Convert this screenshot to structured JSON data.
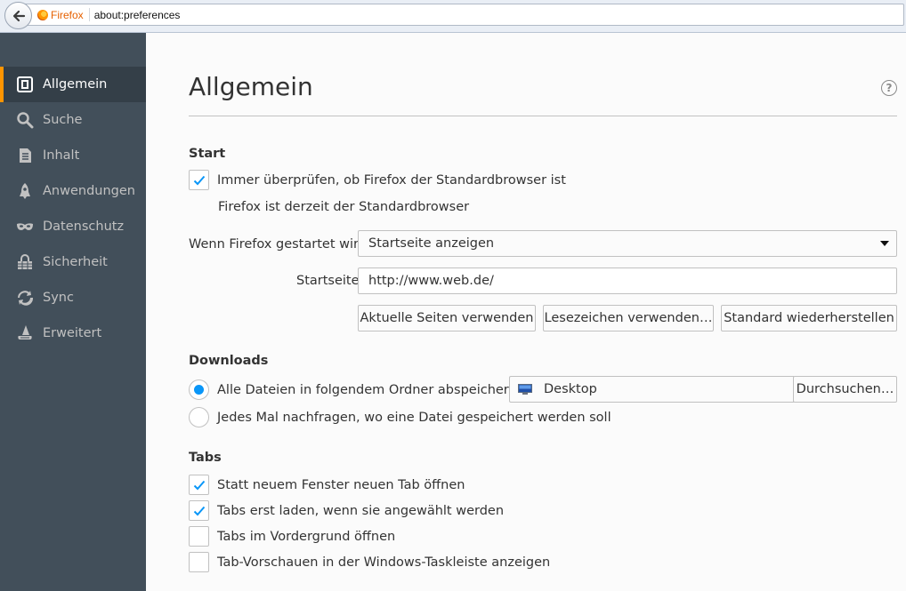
{
  "urlbar": {
    "identity_label": "Firefox",
    "url": "about:preferences"
  },
  "sidebar": {
    "items": [
      {
        "label": "Allgemein",
        "icon": "general-icon",
        "selected": true
      },
      {
        "label": "Suche",
        "icon": "search-icon"
      },
      {
        "label": "Inhalt",
        "icon": "content-icon"
      },
      {
        "label": "Anwendungen",
        "icon": "applications-icon"
      },
      {
        "label": "Datenschutz",
        "icon": "privacy-mask-icon"
      },
      {
        "label": "Sicherheit",
        "icon": "security-icon"
      },
      {
        "label": "Sync",
        "icon": "sync-icon"
      },
      {
        "label": "Erweitert",
        "icon": "advanced-wizard-hat-icon"
      }
    ]
  },
  "main": {
    "title": "Allgemein",
    "help_symbol": "?",
    "start": {
      "title": "Start",
      "default_check_label": "Immer überprüfen, ob Firefox der Standardbrowser ist",
      "default_check_checked": true,
      "default_status": "Firefox ist derzeit der Standardbrowser",
      "startup_label": "Wenn Firefox gestartet wird:",
      "startup_value": "Startseite anzeigen",
      "homepage_label": "Startseite:",
      "homepage_value": "http://www.web.de/",
      "btn_current": "Aktuelle Seiten verwenden",
      "btn_bookmark": "Lesezeichen verwenden…",
      "btn_restore": "Standard wiederherstellen"
    },
    "downloads": {
      "title": "Downloads",
      "save_to_label": "Alle Dateien in folgendem Ordner abspeichern:",
      "save_to_selected": true,
      "folder": "Desktop",
      "browse": "Durchsuchen…",
      "ask_label": "Jedes Mal nachfragen, wo eine Datei gespeichert werden soll"
    },
    "tabs": {
      "title": "Tabs",
      "options": [
        {
          "label": "Statt neuem Fenster neuen Tab öffnen",
          "checked": true
        },
        {
          "label": "Tabs erst laden, wenn sie angewählt werden",
          "checked": true
        },
        {
          "label": "Tabs im Vordergrund öffnen",
          "checked": false
        },
        {
          "label": "Tab-Vorschauen in der Windows-Taskleiste anzeigen",
          "checked": false
        }
      ]
    }
  },
  "colors": {
    "accent": "#ff9500",
    "check": "#0996f8",
    "sidebar": "#424f5a",
    "sidebar_selected": "#343f48"
  }
}
